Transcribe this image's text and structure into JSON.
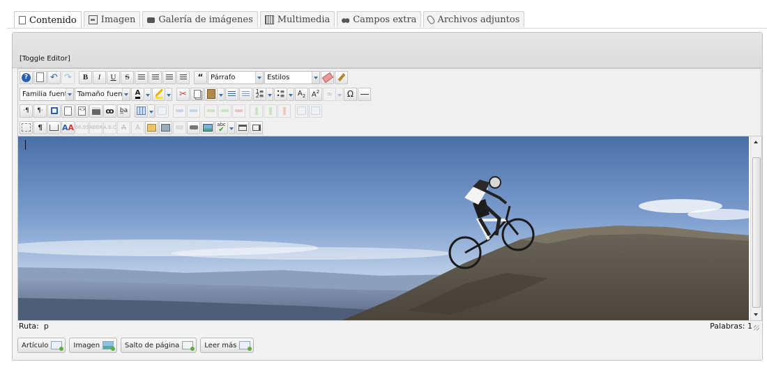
{
  "tabs": [
    {
      "label": "Contenido",
      "icon": "edit-doc-icon",
      "active": true
    },
    {
      "label": "Imagen",
      "icon": "image-icon"
    },
    {
      "label": "Galería de imágenes",
      "icon": "camera-icon"
    },
    {
      "label": "Multimedia",
      "icon": "film-icon"
    },
    {
      "label": "Campos extra",
      "icon": "binoculars-icon"
    },
    {
      "label": "Archivos adjuntos",
      "icon": "paperclip-icon"
    }
  ],
  "editor": {
    "toggle_label": "[Toggle Editor]",
    "format_select": "Párrafo",
    "styles_select": "Estilos",
    "font_family_select": "Familia fuente",
    "font_size_select": "Tamaño fuente",
    "status_path_label": "Ruta:",
    "status_path_value": "p",
    "word_count": "Palabras: 1"
  },
  "buttons": {
    "article": "Artículo",
    "image": "Imagen",
    "page_break": "Salto de página",
    "read_more": "Leer más"
  },
  "colors": {
    "sky_top": "#4a6fa8",
    "sky_mid": "#8fb0d8",
    "accent_blue": "#2b5fb0",
    "rock": "#5b564c"
  }
}
